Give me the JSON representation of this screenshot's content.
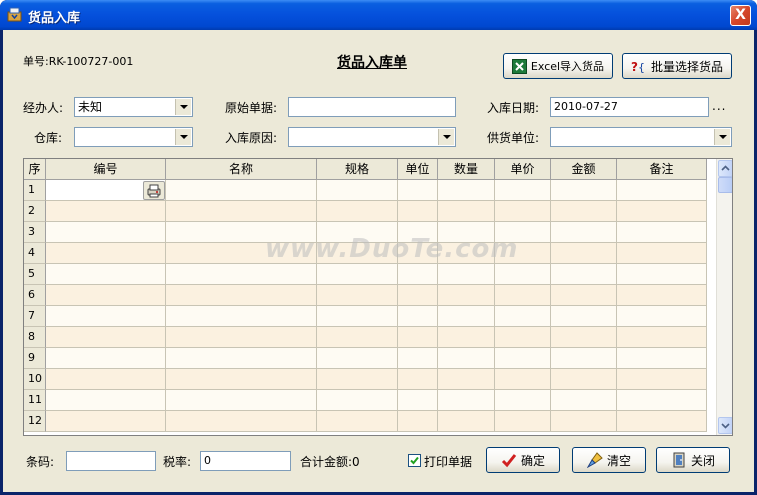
{
  "window": {
    "title": "货品入库",
    "close_glyph": "X"
  },
  "header": {
    "order_no": "单号:RK-100727-001",
    "form_title": "货品入库单"
  },
  "buttons": {
    "excel_import": "Excel导入货品",
    "batch_select": "批量选择货品",
    "confirm": "确定",
    "clear": "清空",
    "close": "关闭"
  },
  "fields": {
    "handler_label": "经办人:",
    "handler_value": "未知",
    "origin_doc_label": "原始单据:",
    "origin_doc_value": "",
    "in_date_label": "入库日期:",
    "in_date_value": "2010-07-27",
    "in_date_more": "...",
    "warehouse_label": "仓库:",
    "warehouse_value": "",
    "reason_label": "入库原因:",
    "reason_value": "",
    "supplier_label": "供货单位:",
    "supplier_value": ""
  },
  "table": {
    "columns": [
      "序",
      "编号",
      "名称",
      "规格",
      "单位",
      "数量",
      "单价",
      "金额",
      "备注"
    ],
    "rows": [
      "1",
      "2",
      "3",
      "4",
      "5",
      "6",
      "7",
      "8",
      "9",
      "10",
      "11",
      "12"
    ]
  },
  "footer": {
    "barcode_label": "条码:",
    "barcode_value": "",
    "tax_label": "税率:",
    "tax_value": "0",
    "total_label": "合计金额:0",
    "print_label": "打印单据",
    "print_checked": true
  },
  "watermark": "www.DuoTe.com",
  "icons": [
    "app-icon",
    "close-icon",
    "excel-icon",
    "batch-select-icon",
    "lookup-icon",
    "confirm-check-icon",
    "clear-brush-icon",
    "close-door-icon"
  ],
  "colors": {
    "titlebar": "#0550dc",
    "client_bg": "#ece9d8",
    "row_odd": "#fefbf3",
    "row_even": "#fbf1e0"
  }
}
